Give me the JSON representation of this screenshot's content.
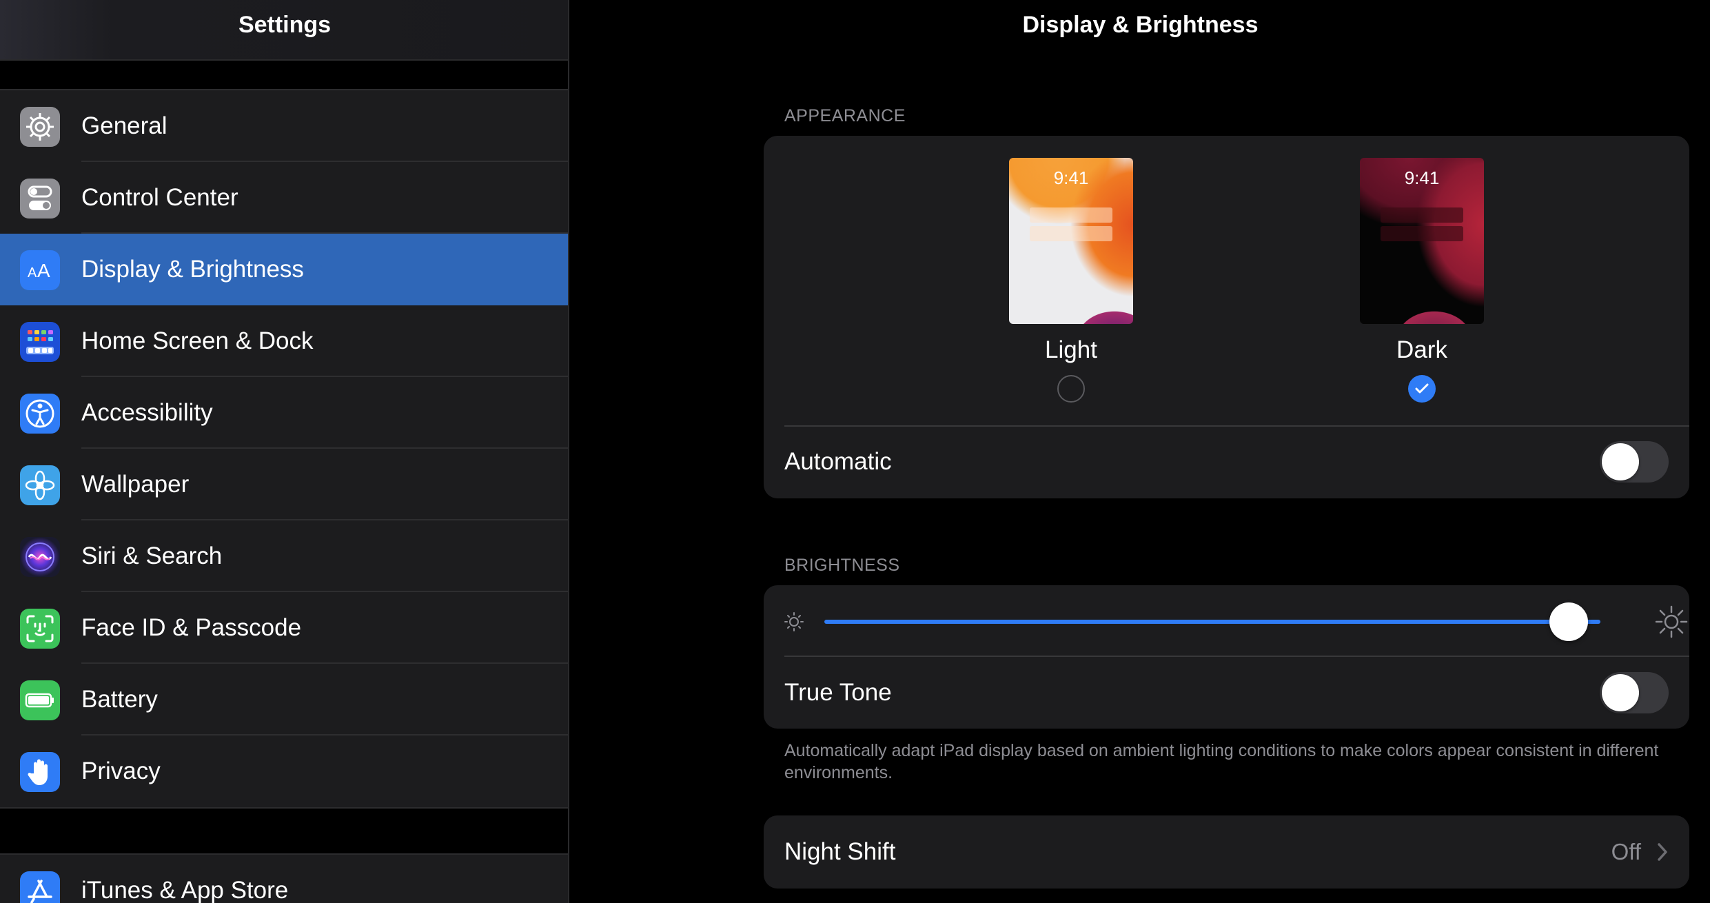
{
  "sidebar": {
    "title": "Settings",
    "items": [
      {
        "label": "General",
        "icon": "gear-icon",
        "color": "#8e8e93"
      },
      {
        "label": "Control Center",
        "icon": "switches-icon",
        "color": "#8e8e93"
      },
      {
        "label": "Display & Brightness",
        "icon": "text-size-icon",
        "color": "#2f7cf6",
        "selected": true
      },
      {
        "label": "Home Screen & Dock",
        "icon": "app-grid-icon",
        "color": "#1d4fd6"
      },
      {
        "label": "Accessibility",
        "icon": "accessibility-icon",
        "color": "#2f7cf6"
      },
      {
        "label": "Wallpaper",
        "icon": "flower-icon",
        "color": "#3fa3e8"
      },
      {
        "label": "Siri & Search",
        "icon": "siri-icon",
        "color": "#5a36d9"
      },
      {
        "label": "Face ID & Passcode",
        "icon": "face-id-icon",
        "color": "#3cc35a"
      },
      {
        "label": "Battery",
        "icon": "battery-icon",
        "color": "#3cc35a"
      },
      {
        "label": "Privacy",
        "icon": "hand-icon",
        "color": "#2f7cf6"
      }
    ],
    "items2": [
      {
        "label": "iTunes & App Store",
        "icon": "app-store-icon",
        "color": "#2f7cf6"
      }
    ]
  },
  "main": {
    "title": "Display & Brightness",
    "appearance": {
      "section_label": "APPEARANCE",
      "light": {
        "label": "Light",
        "time": "9:41",
        "selected": false
      },
      "dark": {
        "label": "Dark",
        "time": "9:41",
        "selected": true
      },
      "automatic_label": "Automatic",
      "automatic_on": false
    },
    "brightness": {
      "section_label": "BRIGHTNESS",
      "level_fraction": 0.95,
      "true_tone_label": "True Tone",
      "true_tone_on": false,
      "footnote": "Automatically adapt iPad display based on ambient lighting conditions to make colors appear consistent in different environments."
    },
    "night_shift": {
      "label": "Night Shift",
      "value": "Off"
    }
  },
  "colors": {
    "accent": "#2f7cf6",
    "selected_row": "#2f67b8"
  }
}
